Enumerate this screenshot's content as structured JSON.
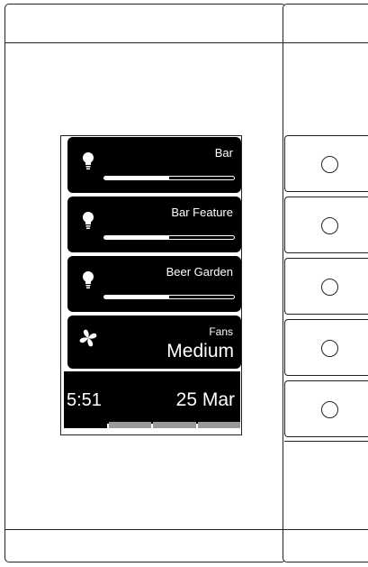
{
  "tiles": [
    {
      "name": "Bar",
      "icon": "bulb-icon",
      "level": 0.5
    },
    {
      "name": "Bar Feature",
      "icon": "bulb-icon",
      "level": 0.5
    },
    {
      "name": "Beer Garden",
      "icon": "bulb-icon",
      "level": 0.5
    }
  ],
  "fan": {
    "name": "Fans",
    "value": "Medium",
    "icon": "fan-icon"
  },
  "status": {
    "time": "5:51",
    "date": "25 Mar"
  },
  "pages": {
    "count": 4,
    "active": 0
  },
  "side_buttons": {
    "count": 5
  },
  "colors": {
    "tile": "#000000",
    "text": "#ffffff",
    "frame": "#222222",
    "page_inactive": "#999999"
  }
}
